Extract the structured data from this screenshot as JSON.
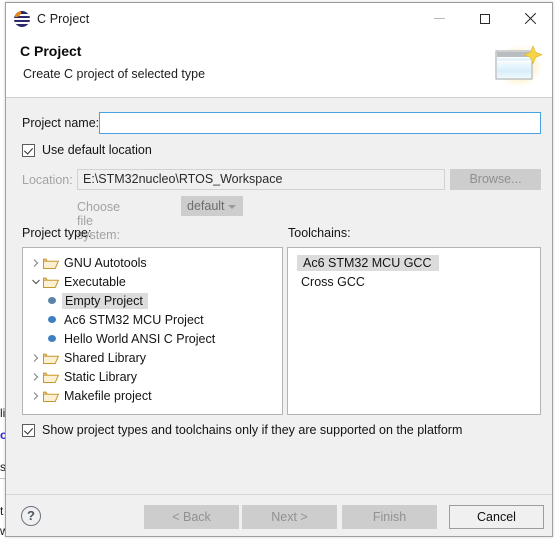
{
  "window": {
    "title": "C Project",
    "title_icon": "eclipse-icon",
    "controls": {
      "minimize": "minimize-icon",
      "maximize": "maximize-icon",
      "close": "close-icon"
    }
  },
  "header": {
    "title": "C Project",
    "description": "Create C project of selected type",
    "banner_icon": "wizard-window-sparkle-icon"
  },
  "form": {
    "project_name": {
      "label": "Project name:",
      "value": "",
      "placeholder": ""
    },
    "use_default_location": {
      "label": "Use default location",
      "checked": true
    },
    "location": {
      "label": "Location:",
      "value": "E:\\STM32nucleo\\RTOS_Workspace",
      "enabled": false
    },
    "browse_button": {
      "label": "Browse...",
      "enabled": false
    },
    "file_system": {
      "label": "Choose file system:",
      "selected": "default",
      "options": [
        "default"
      ],
      "enabled": false
    }
  },
  "project_type": {
    "label": "Project type:",
    "tree": [
      {
        "label": "GNU Autotools",
        "kind": "folder",
        "expanded": false,
        "depth": 0,
        "selected": false
      },
      {
        "label": "Executable",
        "kind": "folder",
        "expanded": true,
        "depth": 0,
        "selected": false
      },
      {
        "label": "Empty Project",
        "kind": "leaf",
        "depth": 1,
        "selected": true
      },
      {
        "label": "Ac6 STM32 MCU Project",
        "kind": "leaf",
        "depth": 1,
        "selected": false
      },
      {
        "label": "Hello World ANSI C Project",
        "kind": "leaf",
        "depth": 1,
        "selected": false
      },
      {
        "label": "Shared Library",
        "kind": "folder",
        "expanded": false,
        "depth": 0,
        "selected": false
      },
      {
        "label": "Static Library",
        "kind": "folder",
        "expanded": false,
        "depth": 0,
        "selected": false
      },
      {
        "label": "Makefile project",
        "kind": "folder",
        "expanded": false,
        "depth": 0,
        "selected": false
      }
    ]
  },
  "toolchains": {
    "label": "Toolchains:",
    "items": [
      {
        "label": "Ac6 STM32 MCU GCC",
        "selected": true
      },
      {
        "label": "Cross GCC",
        "selected": false
      }
    ]
  },
  "show_only": {
    "label": "Show project types and toolchains only if they are supported on the platform",
    "checked": true
  },
  "buttons": {
    "help": "?",
    "back": {
      "label": "< Back",
      "enabled": false
    },
    "next": {
      "label": "Next >",
      "enabled": false
    },
    "finish": {
      "label": "Finish",
      "enabled": false
    },
    "cancel": {
      "label": "Cancel",
      "enabled": true
    }
  },
  "background": {
    "fragments": [
      "li",
      "o",
      "s",
      "t",
      "w"
    ]
  },
  "colors": {
    "accent_focus": "#4aa1e0",
    "selection": "#dcdcdc",
    "dialog_bg": "#f0f0f0",
    "panel_bg": "#ffffff",
    "disabled_text": "#919191",
    "folder_icon": "#e8b44a",
    "bullet_icon": "#3f7fc1",
    "eclipse_icon": "#2c2a6b"
  }
}
